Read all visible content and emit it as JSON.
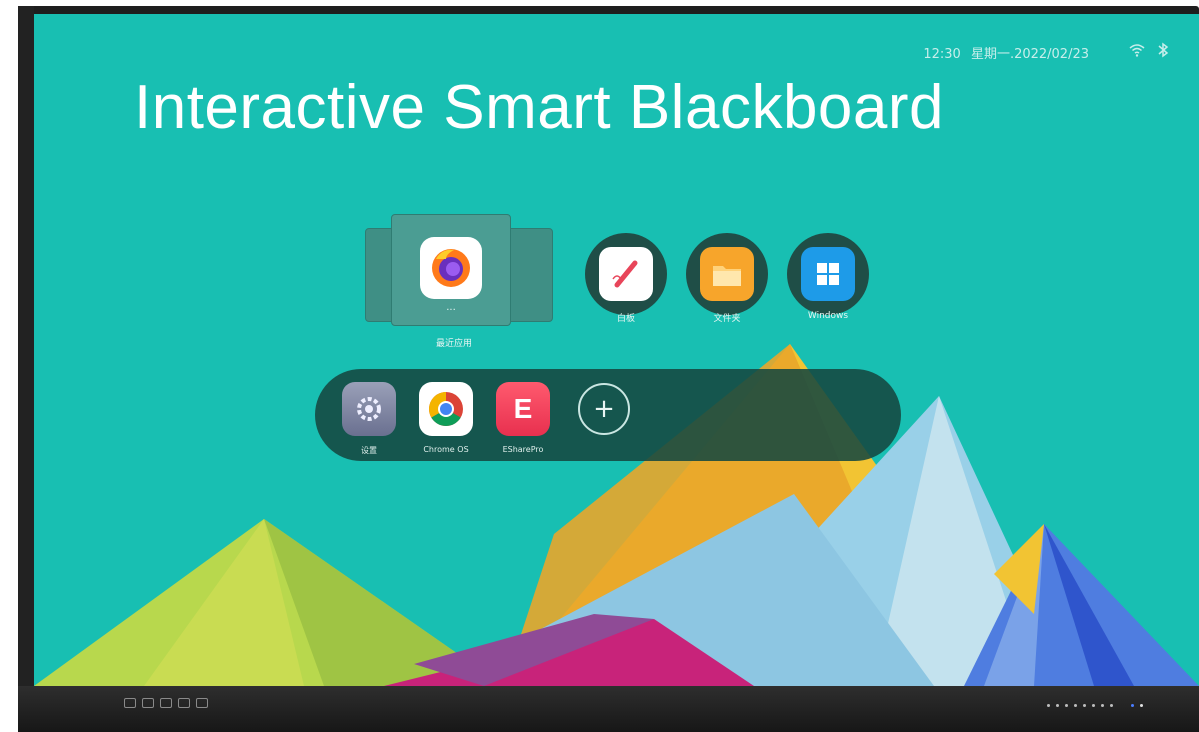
{
  "headline": "Interactive Smart Blackboard",
  "status_bar": {
    "time": "12:30",
    "weekday_date": "星期一.2022/02/23",
    "icons": [
      "wifi-icon",
      "bluetooth-icon"
    ]
  },
  "recent_apps": {
    "label": "最近应用",
    "ellipsis": "···",
    "current_app_icon": "firefox-icon"
  },
  "pinned_apps": [
    {
      "label": "白板",
      "icon": "whiteboard-icon"
    },
    {
      "label": "文件夹",
      "icon": "folder-icon"
    },
    {
      "label": "Windows",
      "icon": "windows-icon"
    }
  ],
  "dock": {
    "apps": [
      {
        "label": "设置",
        "icon": "settings-gear-icon"
      },
      {
        "label": "Chrome OS",
        "icon": "chrome-icon"
      },
      {
        "label": "ESharePro",
        "icon": "eshare-icon"
      }
    ],
    "add_symbol": "+"
  },
  "colors": {
    "screen_background": "#18bfb2",
    "dock_background": "#144840",
    "circle_app_background": "#1f4e47"
  }
}
